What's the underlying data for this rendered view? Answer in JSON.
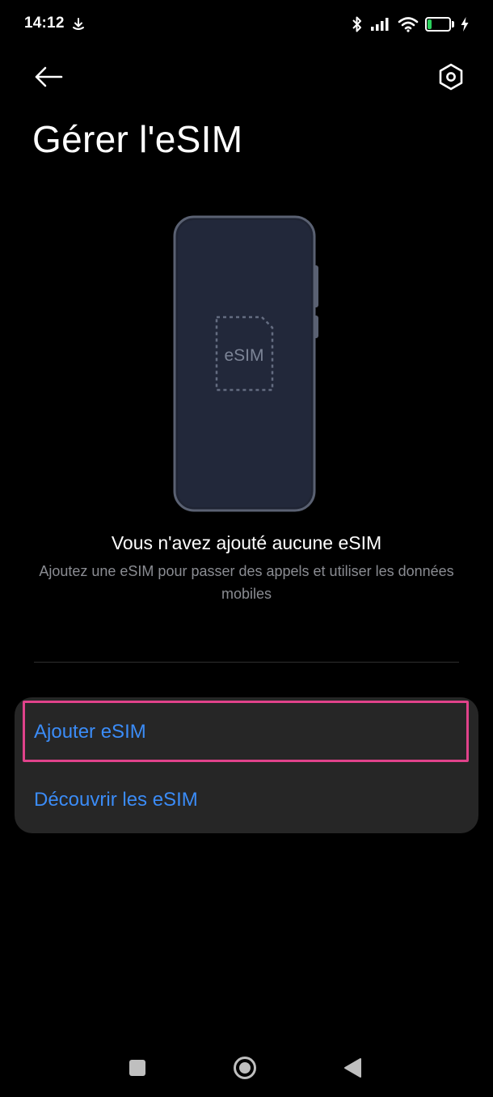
{
  "status_bar": {
    "time": "14:12",
    "battery_level": "19",
    "battery_fraction": 0.19,
    "icons": [
      "download-icon",
      "bluetooth-icon",
      "signal-icon",
      "wifi-icon",
      "battery-icon",
      "charging-icon"
    ]
  },
  "header": {
    "title": "Gérer l'eSIM",
    "back_icon": "arrow-left-icon",
    "settings_icon": "hexagon-settings-icon"
  },
  "illustration": {
    "label": "eSIM"
  },
  "empty_state": {
    "title": "Vous n'avez ajouté aucune eSIM",
    "description": "Ajoutez une eSIM pour passer des appels et utiliser les données mobiles"
  },
  "actions": [
    {
      "label": "Ajouter eSIM"
    },
    {
      "label": "Découvrir les eSIM"
    }
  ],
  "colors": {
    "background": "#000000",
    "card": "#262626",
    "link": "#3b8cf7",
    "highlight": "#e0428a",
    "secondary_text": "#8a8c92",
    "battery": "#2bd15d"
  }
}
